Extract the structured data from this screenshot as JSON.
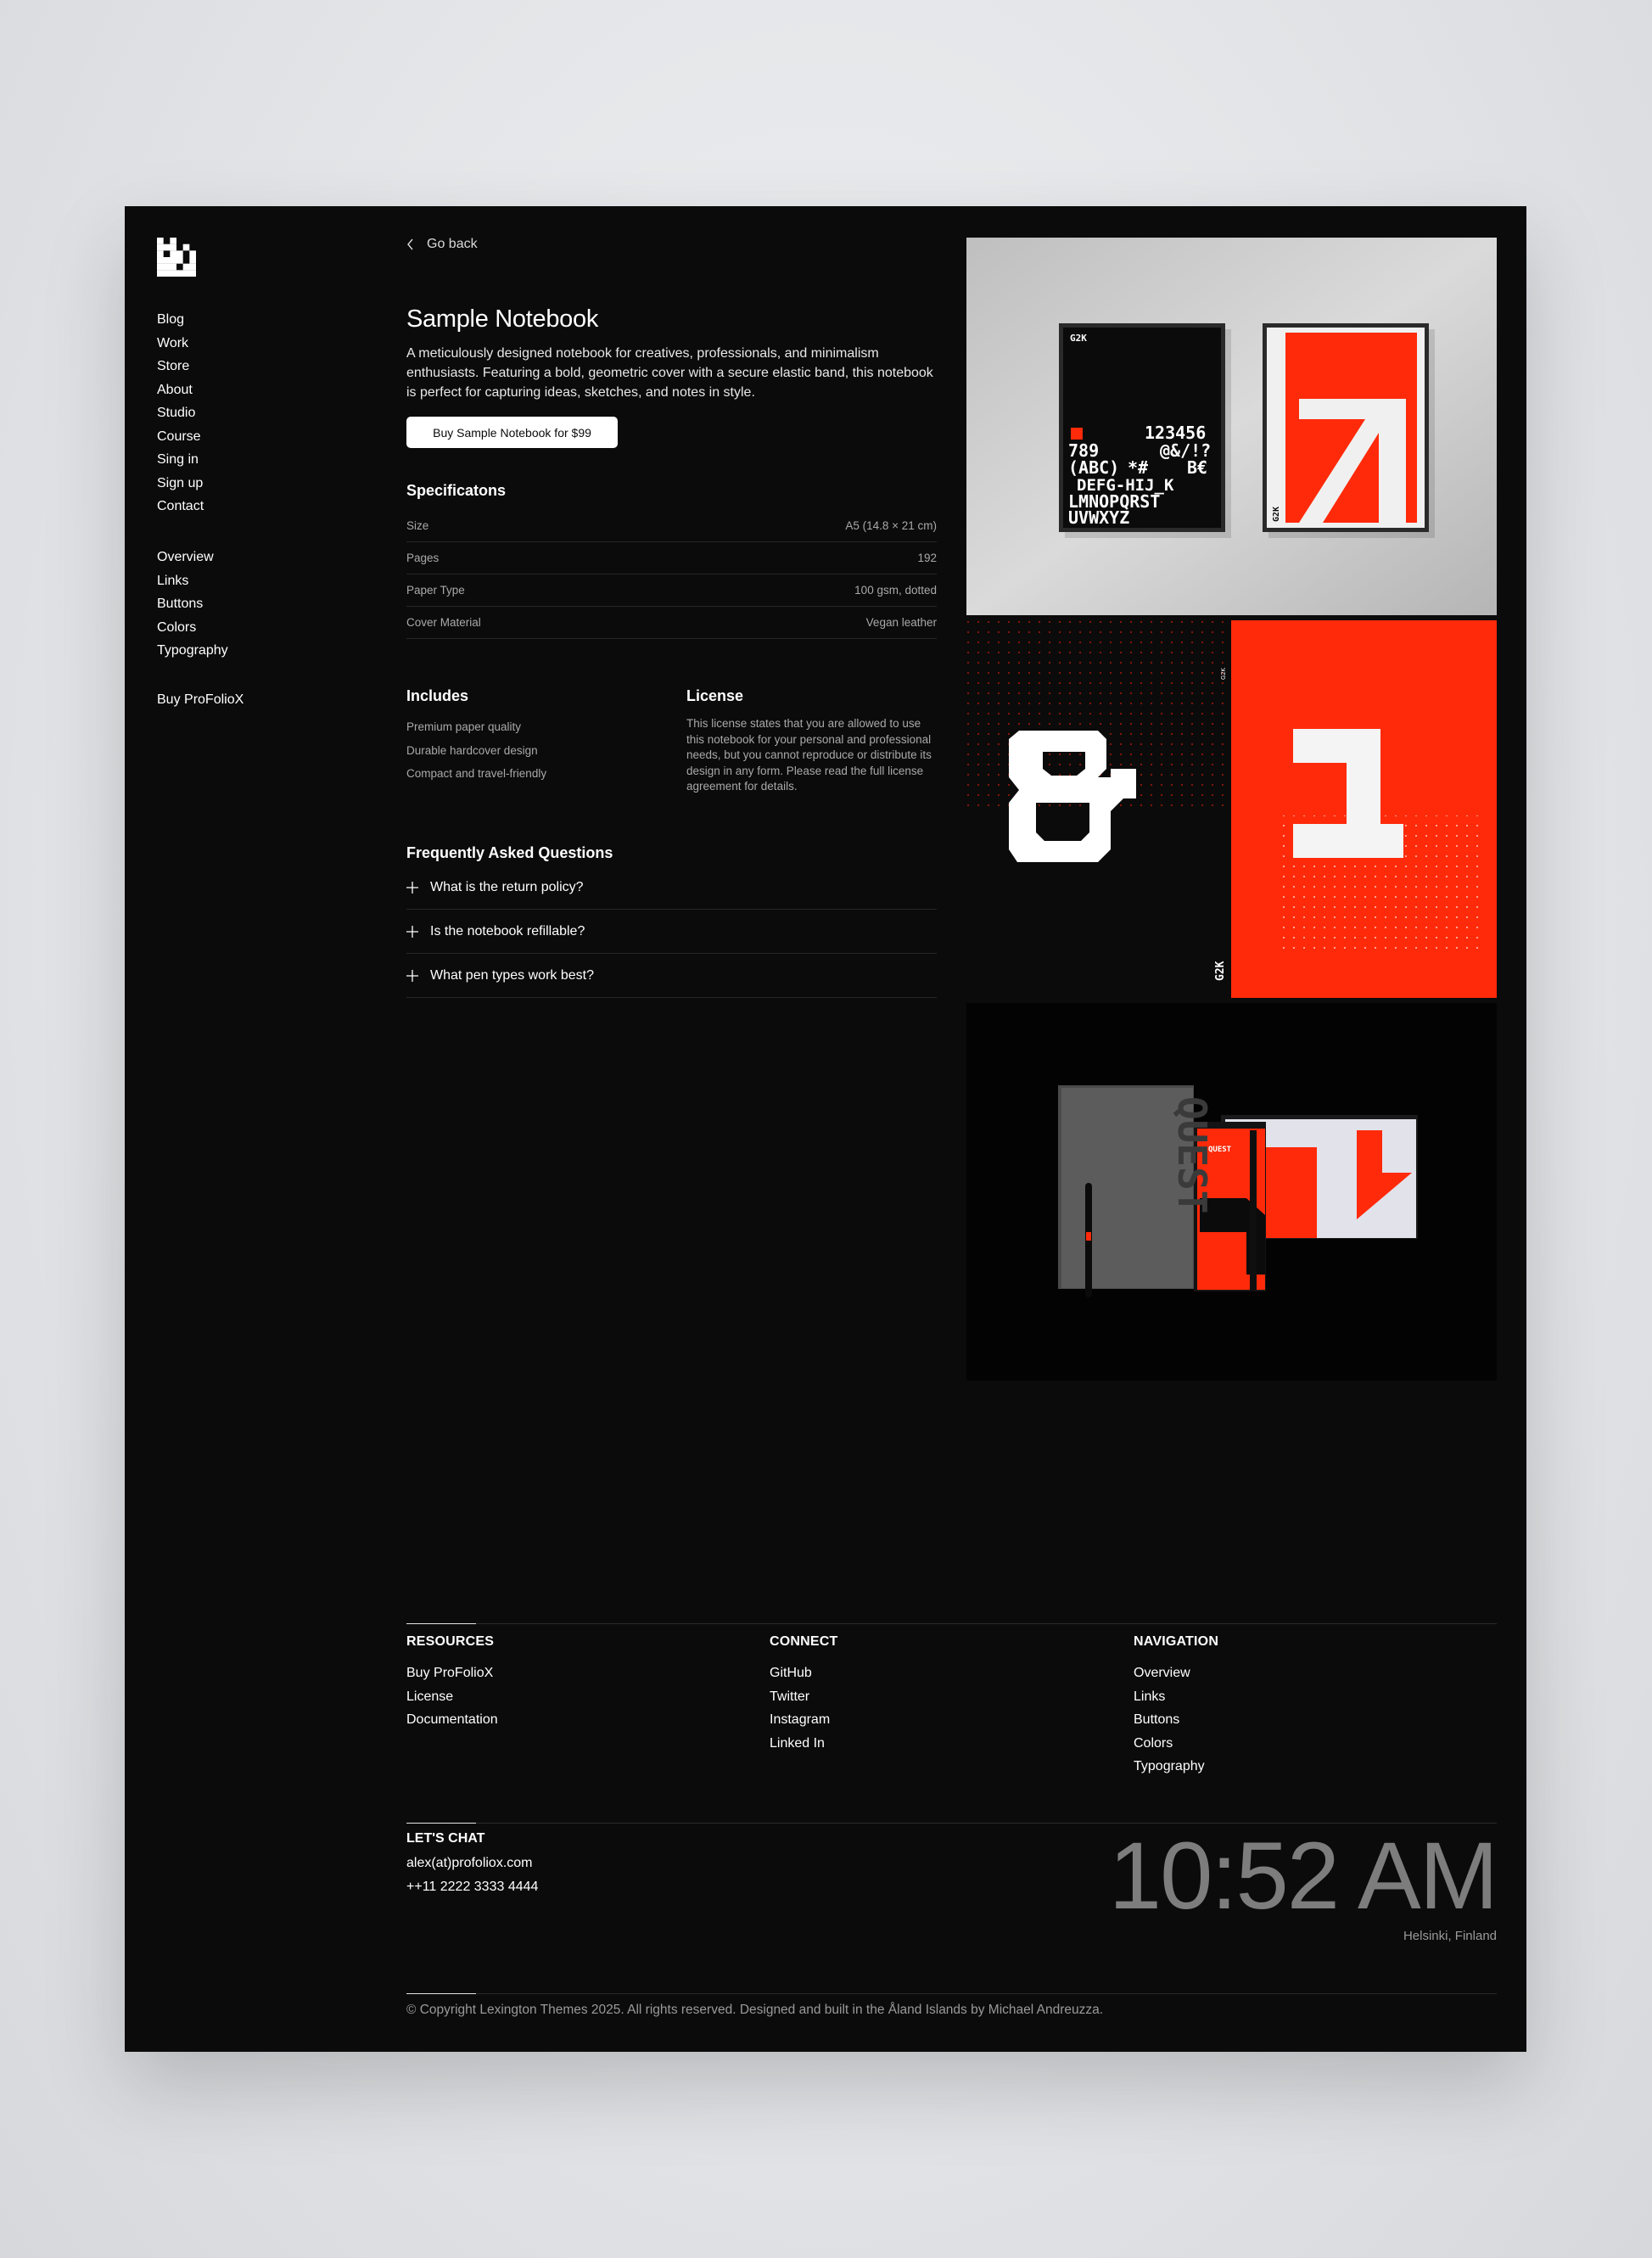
{
  "sidebar": {
    "main_nav": [
      {
        "label": "Blog"
      },
      {
        "label": "Work"
      },
      {
        "label": "Store"
      },
      {
        "label": "About"
      },
      {
        "label": "Studio"
      },
      {
        "label": "Course"
      },
      {
        "label": "Sing in"
      },
      {
        "label": "Sign up"
      },
      {
        "label": "Contact"
      }
    ],
    "ui_nav": [
      {
        "label": "Overview"
      },
      {
        "label": "Links"
      },
      {
        "label": "Buttons"
      },
      {
        "label": "Colors"
      },
      {
        "label": "Typography"
      }
    ],
    "buy_label": "Buy ProFolioX"
  },
  "product": {
    "back_label": "Go back",
    "title": "Sample Notebook",
    "description": "A meticulously designed notebook for creatives, professionals, and minimalism enthusiasts. Featuring a bold, geometric cover with a secure elastic band, this notebook is perfect for capturing ideas, sketches, and notes in style.",
    "buy_button": "Buy Sample Notebook for $99"
  },
  "specs": {
    "heading": "Specificatons",
    "rows": [
      {
        "label": "Size",
        "value": "A5 (14.8 × 21 cm)"
      },
      {
        "label": "Pages",
        "value": "192"
      },
      {
        "label": "Paper Type",
        "value": "100 gsm, dotted"
      },
      {
        "label": "Cover Material",
        "value": "Vegan leather"
      }
    ]
  },
  "includes": {
    "heading": "Includes",
    "items": [
      "Premium paper quality",
      "Durable hardcover design",
      "Compact and travel-friendly"
    ]
  },
  "license": {
    "heading": "License",
    "text": "This license states that you are allowed to use this notebook for your personal and professional needs, but you cannot reproduce or distribute its design in any form. Please read the full license agreement for details."
  },
  "faq": {
    "heading": "Frequently Asked Questions",
    "items": [
      "What is the return policy?",
      "Is the notebook refillable?",
      "What pen types work best?"
    ]
  },
  "gallery": {
    "poster_brand": "G2K",
    "poster_chars": [
      "123456",
      "789",
      "@&/!?",
      "(ABC)",
      "*#",
      "B€",
      "DEFG-HIJ_K",
      "LMNOPQRST",
      "UVWXYZ"
    ],
    "notebook_brand": "QUEST",
    "accent_color": "#ff2a0a"
  },
  "footer": {
    "resources": {
      "heading": "RESOURCES",
      "links": [
        "Buy ProFolioX",
        "License",
        "Documentation"
      ]
    },
    "connect": {
      "heading": "CONNECT",
      "links": [
        "GitHub",
        "Twitter",
        "Instagram",
        "Linked In"
      ]
    },
    "navigation": {
      "heading": "NAVIGATION",
      "links": [
        "Overview",
        "Links",
        "Buttons",
        "Colors",
        "Typography"
      ]
    },
    "chat": {
      "heading": "LET'S CHAT",
      "email": "alex(at)profoliox.com",
      "phone": "++11 2222 3333 4444"
    },
    "time": "10:52 AM",
    "location": "Helsinki, Finland",
    "copyright": "© Copyright Lexington Themes 2025. All rights reserved. Designed and built in the Åland Islands by Michael Andreuzza."
  }
}
